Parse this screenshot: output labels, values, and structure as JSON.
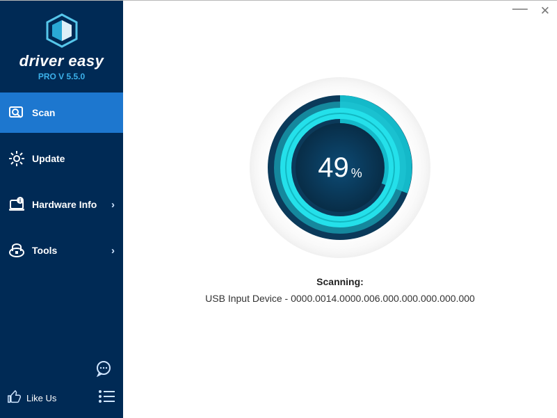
{
  "brand": {
    "name": "driver easy",
    "version_line": "PRO V 5.5.0"
  },
  "nav": {
    "scan": "Scan",
    "update": "Update",
    "hardware_info": "Hardware Info",
    "tools": "Tools"
  },
  "bottom": {
    "like_us": "Like Us"
  },
  "progress": {
    "percent": 49,
    "unit": "%"
  },
  "status": {
    "title": "Scanning:",
    "detail": "USB Input Device - 0000.0014.0000.006.000.000.000.000.000"
  },
  "colors": {
    "sidebar_bg": "#002a55",
    "active_nav": "#1d77cf",
    "accent_cyan": "#1fc9d6",
    "ring_dark": "#0b3a5a"
  }
}
